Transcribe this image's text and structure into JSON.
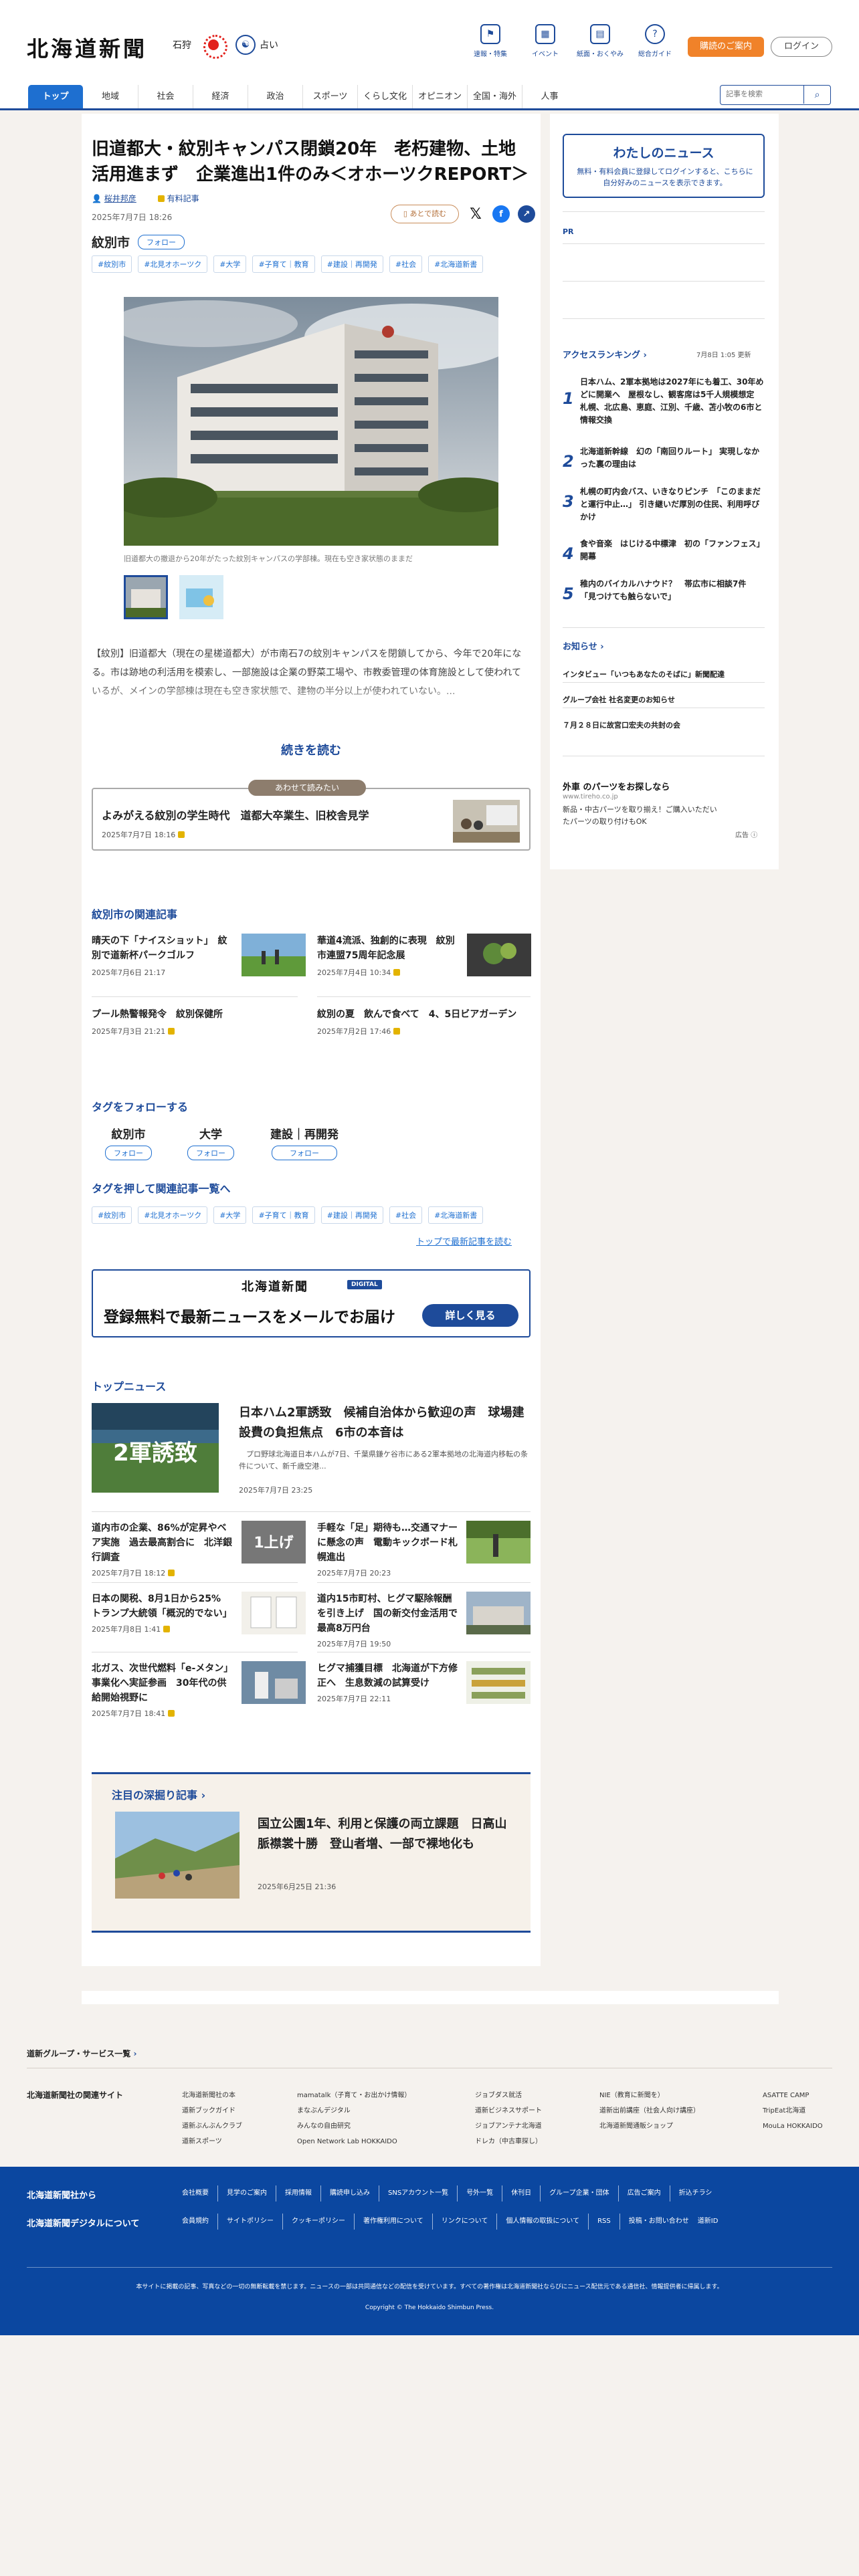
{
  "header": {
    "logo": "北海道新聞",
    "weather_city": "石狩",
    "fortune_label": "占い",
    "icons": [
      {
        "label": "速報・特集",
        "icon": "flag-icon"
      },
      {
        "label": "イベント",
        "icon": "calendar-icon"
      },
      {
        "label": "紙面・おくやみ",
        "icon": "newspaper-icon"
      },
      {
        "label": "総合ガイド",
        "icon": "help-icon"
      }
    ],
    "subscribe_label": "購読のご案内",
    "login_label": "ログイン"
  },
  "nav": {
    "items": [
      "トップ",
      "地域",
      "社会",
      "経済",
      "政治",
      "スポーツ",
      "くらし文化",
      "オピニオン",
      "全国・海外",
      "人事"
    ],
    "search_placeholder": "記事を検索"
  },
  "article": {
    "title": "旧道都大・紋別キャンパス閉鎖20年　老朽建物、土地活用進まず　企業進出1件のみ＜オホーツクREPORT＞",
    "author": "桜井邦彦",
    "paid_label": "有料記事",
    "date": "2025年7月7日 18:26",
    "read_later": "あとで読む",
    "region": "紋別市",
    "follow_label": "フォロー",
    "tags": [
      "#紋別市",
      "#北見オホーツク",
      "#大学",
      "#子育て｜教育",
      "#建設｜再開発",
      "#社会",
      "#北海道新書"
    ],
    "caption": "旧道都大の撤退から20年がたった紋別キャンパスの学部棟。現在も空き家状態のままだ",
    "excerpt": "【紋別】旧道都大（現在の星槎道都大）が市南石7の紋別キャンパスを閉鎖してから、今年で20年になる。市は跡地の利活用を模索し、一部施設は企業の野菜工場や、市教委管理の体育施設として使われているが、メインの学部棟は現在も空き家状態で、建物の半分以上が使われていない。...",
    "read_more": "続きを読む"
  },
  "also_read": {
    "label": "あわせて読みたい",
    "title": "よみがえる紋別の学生時代　道都大卒業生、旧校舎見学",
    "date": "2025年7月7日 18:16"
  },
  "related": {
    "title": "紋別市の関連記事",
    "items": [
      {
        "title": "晴天の下「ナイスショット」　紋別で道新杯パークゴルフ",
        "date": "2025年7月6日 21:17"
      },
      {
        "title": "華道4流派、独創的に表現　紋別市連盟75周年記念展",
        "date": "2025年7月4日 10:34"
      },
      {
        "title": "プール熱警報発令　紋別保健所",
        "date": "2025年7月3日 21:21"
      },
      {
        "title": "紋別の夏　飲んで食べて　4、5日ビアガーデン",
        "date": "2025年7月2日 17:46"
      }
    ]
  },
  "follow_tags": {
    "title": "タグをフォローする",
    "items": [
      "紋別市",
      "大学",
      "建設｜再開発"
    ],
    "follow_label": "フォロー"
  },
  "push_tags": {
    "title": "タグを押して関連記事一覧へ",
    "link": "トップで最新記事を読む"
  },
  "newsletter": {
    "logo": "北海道新聞",
    "badge": "DIGITAL",
    "text": "登録無料で最新ニュースをメールでお届け",
    "button": "詳しく見る"
  },
  "top_news": {
    "title": "トップニュース",
    "lead": {
      "title": "日本ハム2軍誘致　候補自治体から歓迎の声　球場建設費の負担焦点　6市の本音は",
      "summary": "プロ野球北海道日本ハムが7日、千葉県鎌ケ谷市にある2軍本拠地の北海道内移転の条件について、新千歳空港...",
      "date": "2025年7月7日 23:25",
      "img_text": "2軍誘致"
    },
    "items": [
      {
        "title": "道内市の企業、86%が定昇やベア実施　過去最高割合に　北洋銀行調査",
        "date": "2025年7月7日 18:12"
      },
      {
        "title": "手軽な「足」期待も…交通マナーに懸念の声　電動キックボード札幌進出",
        "date": "2025年7月7日 20:23"
      },
      {
        "title": "日本の関税、8月1日から25%　トランプ大統領「概況的でない」",
        "date": "2025年7月8日 1:41"
      },
      {
        "title": "道内15市町村、ヒグマ駆除報酬を引き上げ　国の新交付金活用で最高8万円台",
        "date": "2025年7月7日 19:50"
      },
      {
        "title": "北ガス、次世代燃料「e-メタン」事業化へ実証参画　30年代の供給開始視野に",
        "date": "2025年7月7日 18:41"
      },
      {
        "title": "ヒグマ捕獲目標　北海道が下方修正へ　生息数減の試算受け",
        "date": "2025年7月7日 22:11"
      }
    ],
    "img2_text": "1上げ"
  },
  "deep": {
    "title": "注目の深掘り記事",
    "item_title": "国立公園1年、利用と保護の両立課題　日高山脈襟裳十勝　登山者増、一部で裸地化も",
    "date": "2025年6月25日 21:36"
  },
  "sidebar": {
    "mynews_title": "わたしのニュース",
    "mynews_text": "無料・有料会員に登録してログインすると、こちらに自分好みのニュースを表示できます。",
    "pr": "PR",
    "ranking_title": "アクセスランキング",
    "ranking_updated": "7月8日 1:05 更新",
    "ranking": [
      {
        "no": "1",
        "title": "日本ハム、2軍本拠地は2027年にも着工、30年めどに開業へ　屋根なし、観客席は5千人規模想定　札幌、北広島、恵庭、江別、千歳、苫小牧の6市と情報交換"
      },
      {
        "no": "2",
        "title": "北海道新幹線　幻の「南回りルート」 実現しなかった裏の理由は"
      },
      {
        "no": "3",
        "title": "札幌の町内会バス、いきなりピンチ　「このままだと運行中止…」 引き継いだ厚別の住民、利用呼びかけ"
      },
      {
        "no": "4",
        "title": "食や音楽　はじける中標津　初の「ファンフェス」開幕"
      },
      {
        "no": "5",
        "title": "稚内のバイカルハナウド？　帯広市に相談7件　「見つけても触らないで」"
      }
    ],
    "notice_title": "お知らせ",
    "notices": [
      "インタビュー「いつもあなたのそばに」新聞配達",
      "グループ会社 社名変更のお知らせ",
      "７月２８日に故宮口宏夫の共封の会"
    ],
    "ad_title": "外車 のパーツをお探しなら",
    "ad_url": "www.tireho.co.jp",
    "ad_text": "新品・中古パーツを取り揃え！ご購入いただいたパーツの取り付けもOK",
    "ad_mark": "広告"
  },
  "footer": {
    "group_link": "道新グループ・サービス一覧",
    "related_title": "北海道新聞社の関連サイト",
    "cols": [
      [
        "北海道新聞社の本",
        "道新ブックガイド",
        "道新ぶんぶんクラブ",
        "道新スポーツ"
      ],
      [
        "mamatalk（子育て・お出かけ情報）",
        "まなぶんデジタル",
        "みんなの自由研究",
        "Open Network Lab HOKKAIDO"
      ],
      [
        "ジョブダス就活",
        "道新ビジネスサポート",
        "ジョブアンテナ北海道",
        "ドレカ（中古車探し）"
      ],
      [
        "NIE（教育に新聞を）",
        "道新出前講座（社会人向け講座）",
        "北海道新聞通販ショップ"
      ],
      [
        "ASATTE CAMP",
        "TripEat北海道",
        "MouLa HOKKAIDO"
      ]
    ],
    "company_title": "北海道新聞社から",
    "digital_title": "北海道新聞デジタルについて",
    "company_links": [
      "会社概要",
      "見学のご案内",
      "採用情報",
      "購読申し込み",
      "SNSアカウント一覧",
      "号外一覧",
      "休刊日",
      "グループ企業・団体",
      "広告ご案内",
      "折込チラシ"
    ],
    "digital_links": [
      "会員規約",
      "サイトポリシー",
      "クッキーポリシー",
      "著作権利用について",
      "リンクについて",
      "個人情報の取扱について",
      "RSS",
      "投稿・お問い合わせ",
      "道新ID"
    ],
    "disclaimer": "本サイトに掲載の記事、写真などの一切の無断転載を禁じます。ニュースの一部は共同通信などの配信を受けています。すべての著作権は北海道新聞社ならびにニュース配信元である通信社、情報提供者に帰属します。",
    "copyright": "Copyright © The Hokkaido Shimbun Press."
  },
  "colors": {
    "brand": "#1e4b9a",
    "accent": "#f08229",
    "nav_active": "#1e6fd0",
    "footer": "#0b47a0"
  }
}
